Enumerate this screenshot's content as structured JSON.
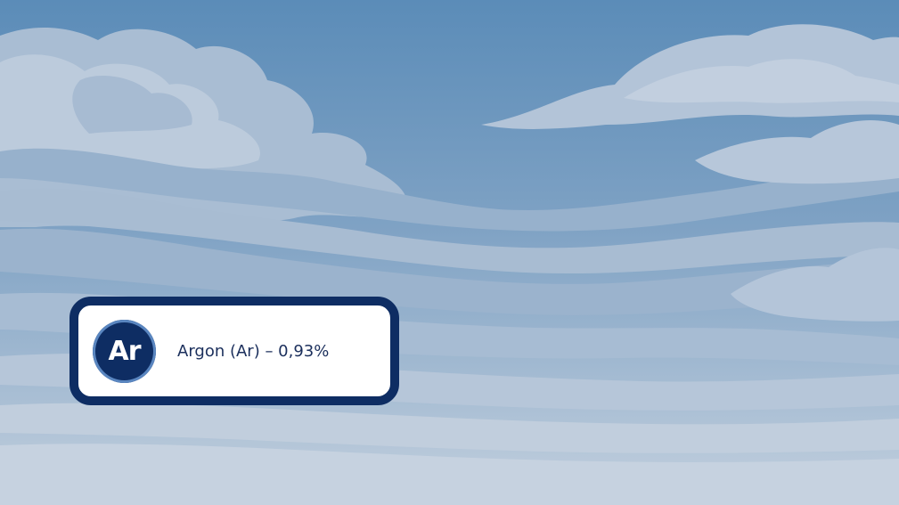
{
  "scene": {
    "background": "sky-with-clouds"
  },
  "colors": {
    "sky_top": "#5e8fba",
    "sky_bottom": "#c5d2e0",
    "cloud_light": "#b9c8d9",
    "cloud_mid": "#9eb6cf",
    "card_border": "#0e2d63",
    "card_background": "#ffffff",
    "text": "#1b2f5c"
  },
  "element_card": {
    "symbol": "Ar",
    "label": "Argon (Ar) – 0,93%"
  }
}
